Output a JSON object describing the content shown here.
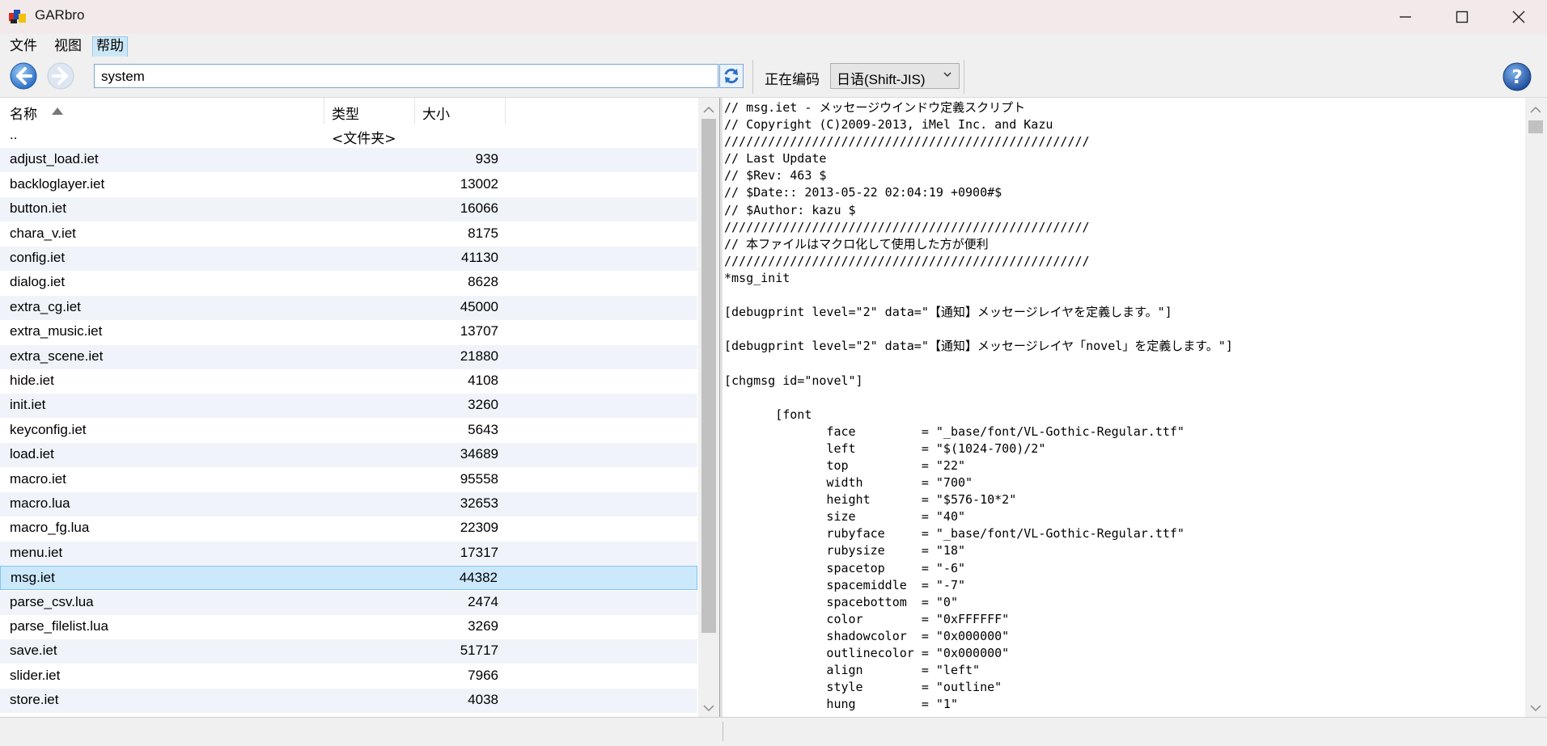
{
  "window": {
    "title": "GARbro"
  },
  "menu": {
    "items": [
      "文件",
      "视图",
      "帮助"
    ]
  },
  "toolbar": {
    "path": "system",
    "encoding_label": "正在编码",
    "encoding_value": "日语(Shift-JIS)"
  },
  "file_list": {
    "columns": {
      "name": "名称",
      "type": "类型",
      "size": "大小"
    },
    "rows": [
      {
        "name": "..",
        "type": "<文件夹>",
        "size": ""
      },
      {
        "name": "adjust_load.iet",
        "type": "",
        "size": "939"
      },
      {
        "name": "backloglayer.iet",
        "type": "",
        "size": "13002"
      },
      {
        "name": "button.iet",
        "type": "",
        "size": "16066"
      },
      {
        "name": "chara_v.iet",
        "type": "",
        "size": "8175"
      },
      {
        "name": "config.iet",
        "type": "",
        "size": "41130"
      },
      {
        "name": "dialog.iet",
        "type": "",
        "size": "8628"
      },
      {
        "name": "extra_cg.iet",
        "type": "",
        "size": "45000"
      },
      {
        "name": "extra_music.iet",
        "type": "",
        "size": "13707"
      },
      {
        "name": "extra_scene.iet",
        "type": "",
        "size": "21880"
      },
      {
        "name": "hide.iet",
        "type": "",
        "size": "4108"
      },
      {
        "name": "init.iet",
        "type": "",
        "size": "3260"
      },
      {
        "name": "keyconfig.iet",
        "type": "",
        "size": "5643"
      },
      {
        "name": "load.iet",
        "type": "",
        "size": "34689"
      },
      {
        "name": "macro.iet",
        "type": "",
        "size": "95558"
      },
      {
        "name": "macro.lua",
        "type": "",
        "size": "32653"
      },
      {
        "name": "macro_fg.lua",
        "type": "",
        "size": "22309"
      },
      {
        "name": "menu.iet",
        "type": "",
        "size": "17317"
      },
      {
        "name": "msg.iet",
        "type": "",
        "size": "44382",
        "selected": true
      },
      {
        "name": "parse_csv.lua",
        "type": "",
        "size": "2474"
      },
      {
        "name": "parse_filelist.lua",
        "type": "",
        "size": "3269"
      },
      {
        "name": "save.iet",
        "type": "",
        "size": "51717"
      },
      {
        "name": "slider.iet",
        "type": "",
        "size": "7966"
      },
      {
        "name": "store.iet",
        "type": "",
        "size": "4038"
      }
    ]
  },
  "preview": {
    "text": "// msg.iet - メッセージウインドウ定義スクリプト\n// Copyright (C)2009-2013, iMel Inc. and Kazu\n//////////////////////////////////////////////////\n// Last Update\n// $Rev: 463 $\n// $Date:: 2013-05-22 02:04:19 +0900#$\n// $Author: kazu $\n//////////////////////////////////////////////////\n// 本ファイルはマクロ化して使用した方が便利\n//////////////////////////////////////////////////\n*msg_init\n\n[debugprint level=\"2\" data=\"【通知】メッセージレイヤを定義します。\"]\n\n[debugprint level=\"2\" data=\"【通知】メッセージレイヤ「novel」を定義します。\"]\n\n[chgmsg id=\"novel\"]\n\n       [font\n              face         = \"_base/font/VL-Gothic-Regular.ttf\"\n              left         = \"$(1024-700)/2\"\n              top          = \"22\"\n              width        = \"700\"\n              height       = \"$576-10*2\"\n              size         = \"40\"\n              rubyface     = \"_base/font/VL-Gothic-Regular.ttf\"\n              rubysize     = \"18\"\n              spacetop     = \"-6\"\n              spacemiddle  = \"-7\"\n              spacebottom  = \"0\"\n              color        = \"0xFFFFFF\"\n              shadowcolor  = \"0x000000\"\n              outlinecolor = \"0x000000\"\n              align        = \"left\"\n              style        = \"outline\"\n              hung         = \"1\""
  },
  "colors": {
    "selection": "#cce8fb",
    "accent": "#2b6fc4"
  }
}
